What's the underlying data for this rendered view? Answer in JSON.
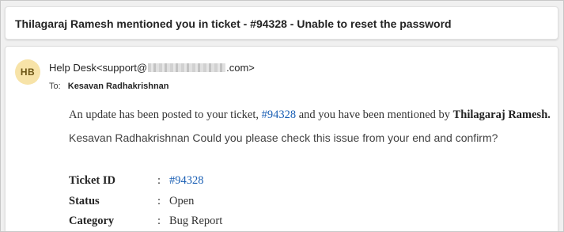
{
  "subject": "Thilagaraj Ramesh mentioned you in ticket - #94328 - Unable to reset the password",
  "message": {
    "avatar_initials": "HB",
    "sender_name": "Help Desk",
    "sender_email_prefix": "<support@",
    "sender_email_suffix": ".com>",
    "to_label": "To:",
    "to_name": "Kesavan Radhakrishnan",
    "para1_before": "An update has been posted to your ticket, ",
    "para1_ticket": "#94328",
    "para1_middle": " and you have been mentioned by ",
    "para1_name": "Thilagaraj Ramesh.",
    "para2": "Kesavan Radhakrishnan Could you please check this issue from your end and confirm?",
    "fields": [
      {
        "label": "Ticket ID",
        "colon": ":",
        "value": "#94328"
      },
      {
        "label": "Status",
        "colon": ":",
        "value": "Open"
      },
      {
        "label": "Category",
        "colon": ":",
        "value": "Bug Report"
      }
    ]
  },
  "colors": {
    "link": "#1a5fb4",
    "avatar_bg": "#f7e3a8",
    "avatar_text": "#6b5414"
  }
}
